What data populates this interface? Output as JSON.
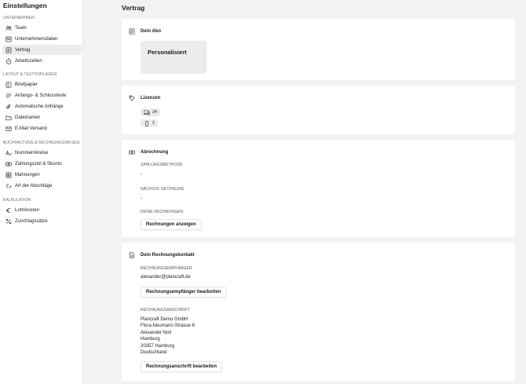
{
  "sidebar": {
    "title": "Einstellungen",
    "sections": [
      {
        "label": "UNTERNEHMEN",
        "items": [
          {
            "label": "Team",
            "icon": "team-icon"
          },
          {
            "label": "Unternehmensdaten",
            "icon": "company-data-icon"
          },
          {
            "label": "Vertrag",
            "icon": "contract-icon",
            "active": true
          },
          {
            "label": "Arbeitszeiten",
            "icon": "stopwatch-icon"
          }
        ]
      },
      {
        "label": "LAYOUT & TEXTVORLAGEN",
        "items": [
          {
            "label": "Briefpapier",
            "icon": "letterhead-icon"
          },
          {
            "label": "Anfangs- & Schlusstexte",
            "icon": "text-lines-icon"
          },
          {
            "label": "Automatische Anhänge",
            "icon": "paperclip-icon"
          },
          {
            "label": "Dateinamen",
            "icon": "folder-icon"
          },
          {
            "label": "E-Mail Versand",
            "icon": "mail-icon"
          }
        ]
      },
      {
        "label": "BUCHHALTUNG & RECHNUNGSWESEN",
        "items": [
          {
            "label": "Nummernkreise",
            "icon": "numbering-icon"
          },
          {
            "label": "Zahlungsziel & Skonto",
            "icon": "payment-icon"
          },
          {
            "label": "Mahnungen",
            "icon": "reminder-icon"
          },
          {
            "label": "Art der Abschläge",
            "icon": "installment-icon"
          }
        ]
      },
      {
        "label": "KALKULATION",
        "items": [
          {
            "label": "Lohnkosten",
            "icon": "euro-icon"
          },
          {
            "label": "Zuschlagssätze",
            "icon": "percent-icon"
          }
        ]
      }
    ]
  },
  "main": {
    "title": "Vertrag",
    "abo": {
      "heading": "Dein Abo",
      "plan": "Personalisiert"
    },
    "licenses": {
      "heading": "Lizenzen",
      "desktop_count": "24",
      "mobile_count": "2"
    },
    "billing": {
      "heading": "Abrechnung",
      "payment_method_label": "ZAHLUNGSMETHODE",
      "payment_method_value": "-",
      "next_invoice_label": "NÄCHSTE RECHNUNG",
      "next_invoice_value": "-",
      "invoices_label": "DEINE RECHNUNGEN",
      "show_invoices_button": "Rechnungen anzeigen"
    },
    "contact": {
      "heading": "Dein Rechnungskontakt",
      "recipient_label": "RECHNUNGSEMPFÄNGER",
      "recipient_email": "alexander@plancraft.de",
      "edit_recipient_button": "Rechnungsempfänger bearbeiten",
      "address_label": "RECHNUNGSANSCHRIFT",
      "address_lines": [
        "Plancraft Demo GmbH",
        "Flora-Neumann-Strasse 6",
        "Alexander Noll",
        "Hamburg",
        "20357 Hamburg",
        "Deutschland"
      ],
      "edit_address_button": "Rechnungsanschrift bearbeiten"
    }
  }
}
